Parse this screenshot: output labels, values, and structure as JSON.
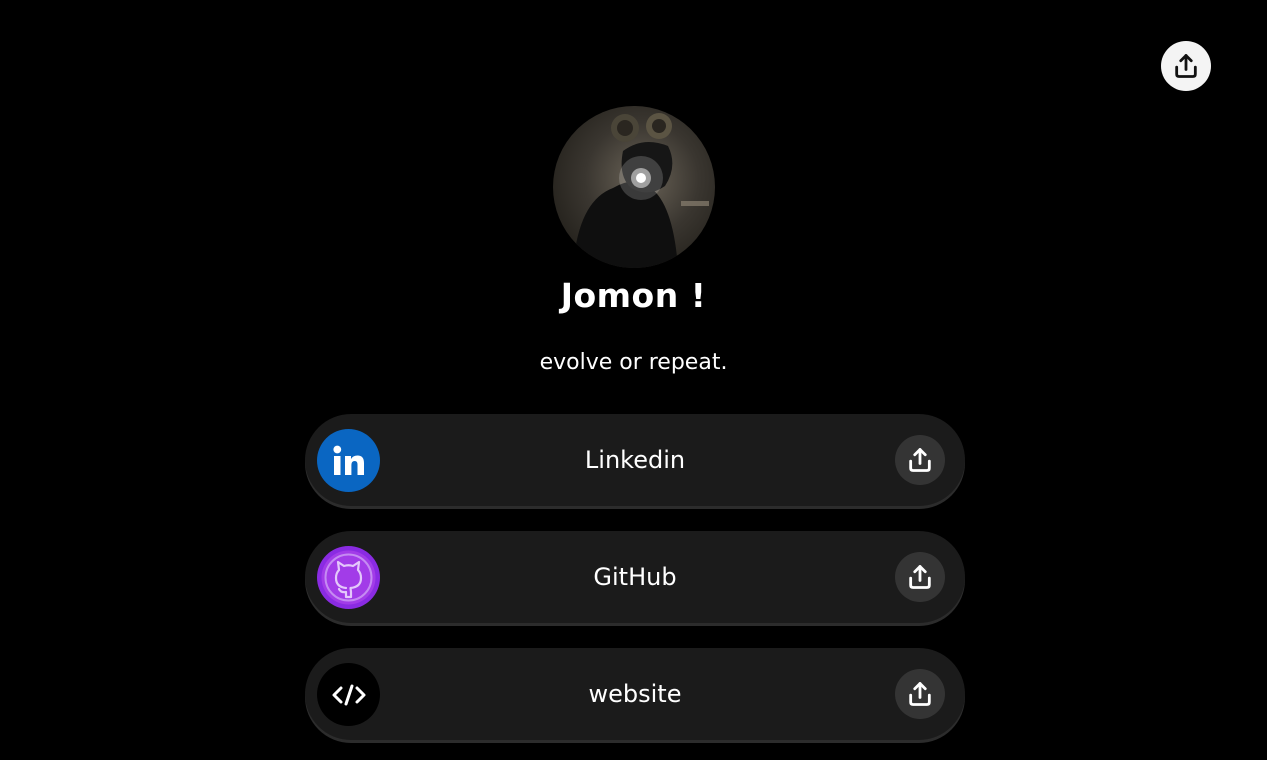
{
  "header": {
    "share_icon": "share-upload-icon"
  },
  "profile": {
    "name": "Jomon !",
    "bio": "evolve or repeat."
  },
  "links": [
    {
      "label": "Linkedin",
      "icon": "linkedin-icon",
      "icon_bg": "#0a66c2",
      "share_icon": "share-upload-icon"
    },
    {
      "label": "GitHub",
      "icon": "github-icon",
      "icon_bg": "#8a2be2",
      "share_icon": "share-upload-icon"
    },
    {
      "label": "website",
      "icon": "code-icon",
      "icon_bg": "#000000",
      "share_icon": "share-upload-icon"
    }
  ],
  "colors": {
    "background": "#000000",
    "card": "#1b1b1b",
    "card_share": "#343434",
    "top_share": "#f4f4f4",
    "text": "#ffffff"
  }
}
